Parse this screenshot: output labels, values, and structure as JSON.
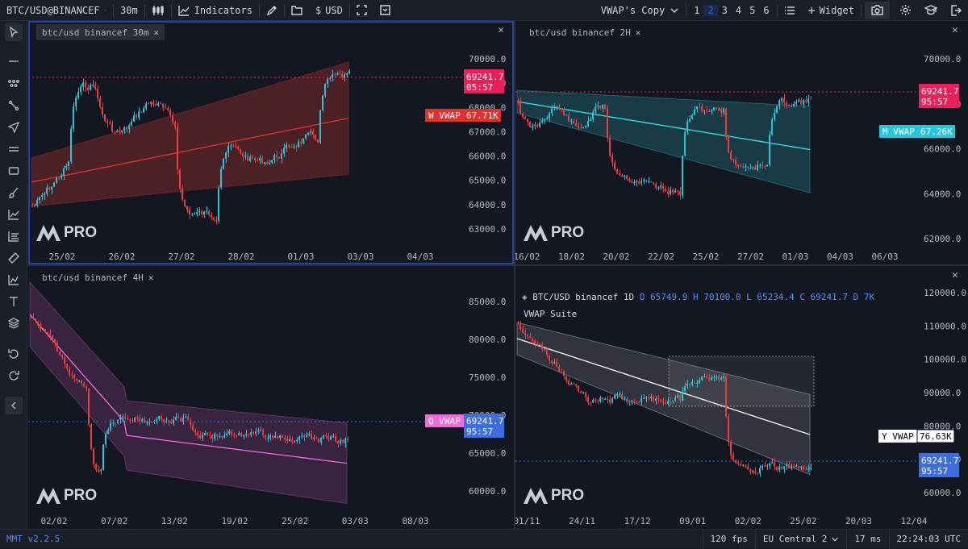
{
  "topbar": {
    "symbol": "BTC/USD@BINANCEF",
    "interval": "30m",
    "indicators_label": "Indicators",
    "currency": "USD",
    "layout_name": "VWAP's Copy",
    "layout_numbers": [
      "1",
      "2",
      "3",
      "4",
      "5",
      "6"
    ],
    "active_layout": "2",
    "widget_label": "Widget"
  },
  "status": {
    "version": "MMT v2.2.5",
    "fps": "120 fps",
    "region": "EU Central 2",
    "latency": "17 ms",
    "time": "22:24:03 UTC"
  },
  "logo_text": "PRO",
  "panels": [
    {
      "id": "tl",
      "tab": "btc/usd binancef 30m",
      "active": true,
      "price_ticks": [
        "70000.0",
        "69000.0",
        "68000.0",
        "67000.0",
        "66000.0",
        "65000.0",
        "64000.0",
        "63000.0"
      ],
      "date_ticks": [
        "25/02",
        "26/02",
        "27/02",
        "28/02",
        "01/03",
        "03/03",
        "04/03"
      ],
      "price_label": "69241.7",
      "countdown": "05:57",
      "vwap_tag": "W VWAP",
      "vwap_value": "67.71K",
      "colors": {
        "band": "#7a2a2a",
        "line": "#e2312b",
        "tag_bg": "#e2312b",
        "price_bg": "#ec1f5a",
        "dot": "#ec1f5a"
      }
    },
    {
      "id": "tr",
      "tab": "btc/usd binancef 2H",
      "active": false,
      "price_ticks": [
        "70000.0",
        "68000.0",
        "66000.0",
        "64000.0",
        "62000.0"
      ],
      "date_ticks": [
        "16/02",
        "18/02",
        "20/02",
        "22/02",
        "25/02",
        "27/02",
        "01/03",
        "04/03",
        "06/03"
      ],
      "price_label": "69241.7",
      "countdown": "95:57",
      "vwap_tag": "M VWAP",
      "vwap_value": "67.26K",
      "colors": {
        "band": "#1f5a62",
        "line": "#2ee6f0",
        "tag_bg": "#26c6da",
        "price_bg": "#ec1f5a",
        "dot": "#ec1f5a"
      }
    },
    {
      "id": "bl",
      "tab": "btc/usd binancef 4H",
      "active": false,
      "price_ticks": [
        "85000.0",
        "80000.0",
        "75000.0",
        "70000.0",
        "65000.0",
        "60000.0"
      ],
      "date_ticks": [
        "02/02",
        "07/02",
        "13/02",
        "19/02",
        "25/02",
        "03/03",
        "08/03"
      ],
      "price_label": "69241.7",
      "countdown": "95:57",
      "vwap_tag": "Q VWAP",
      "vwap_value": "",
      "colors": {
        "band": "#5a2f58",
        "line": "#f06ad8",
        "tag_bg": "#f06ad8",
        "price_bg": "#3d6ee0",
        "dot": "#3d6ee0"
      }
    },
    {
      "id": "br",
      "tab": "",
      "active": false,
      "legend": {
        "symbol": "BTC/USD binancef 1D",
        "o": "O 65749.9",
        "h": "H 70100.0",
        "l": "L 65234.4",
        "c": "C 69241.7",
        "d": "D 7K",
        "indicator": "VWAP Suite"
      },
      "price_ticks": [
        "120000.0",
        "110000.0",
        "100000.0",
        "90000.0",
        "80000.0",
        "70000.0",
        "60000.0"
      ],
      "date_ticks": [
        "01/11",
        "24/11",
        "17/12",
        "09/01",
        "02/02",
        "25/02",
        "20/03",
        "12/04"
      ],
      "price_label": "69241.7",
      "countdown": "95:57",
      "vwap_tag": "Y VWAP",
      "vwap_value": "76.63K",
      "colors": {
        "band": "#4a4d55",
        "line": "#ffffff",
        "tag_bg": "#ffffff",
        "price_bg": "#3d6ee0",
        "dot": "#3d6ee0"
      }
    }
  ]
}
